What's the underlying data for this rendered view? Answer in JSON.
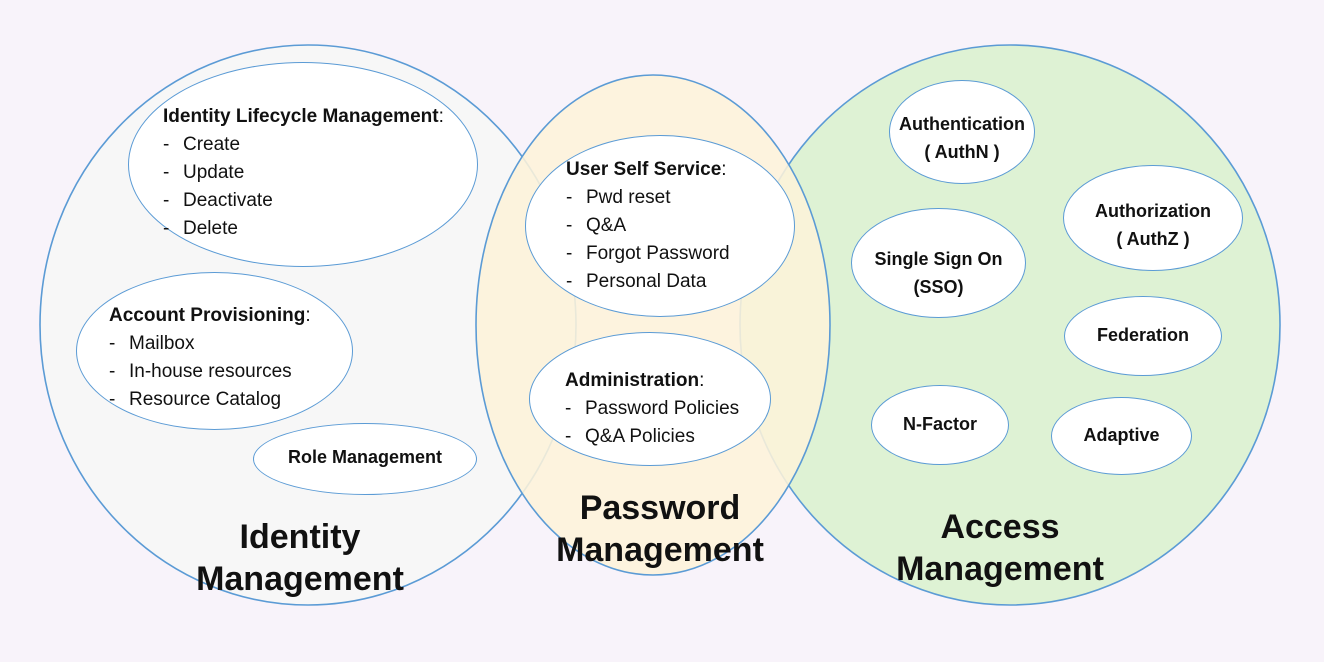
{
  "identity": {
    "title_line1": "Identity",
    "title_line2": "Management",
    "lifecycle": {
      "heading": "Identity Lifecycle Management",
      "items": [
        "Create",
        "Update",
        "Deactivate",
        "Delete"
      ]
    },
    "provisioning": {
      "heading": "Account Provisioning",
      "items": [
        "Mailbox",
        "In-house resources",
        "Resource Catalog"
      ]
    },
    "role": "Role Management"
  },
  "password": {
    "title_line1": "Password",
    "title_line2": "Management",
    "self_service": {
      "heading": "User Self Service",
      "items": [
        "Pwd reset",
        "Q&A",
        "Forgot Password",
        "Personal Data"
      ]
    },
    "administration": {
      "heading": "Administration",
      "items": [
        "Password Policies",
        "Q&A Policies"
      ]
    }
  },
  "access": {
    "title_line1": "Access",
    "title_line2": "Management",
    "authn": {
      "line1": "Authentication",
      "line2": "( AuthN )"
    },
    "authz": {
      "line1": "Authorization",
      "line2": "( AuthZ )"
    },
    "sso": {
      "line1": "Single Sign On",
      "line2": "(SSO)"
    },
    "federation": "Federation",
    "nfactor": "N-Factor",
    "adaptive": "Adaptive"
  },
  "colors": {
    "background": "#f8f3fa",
    "identity_fill": "#f7f7f7",
    "password_fill": "#fdf2d9",
    "access_fill": "#def2d4",
    "outline": "#5b9bd5"
  }
}
